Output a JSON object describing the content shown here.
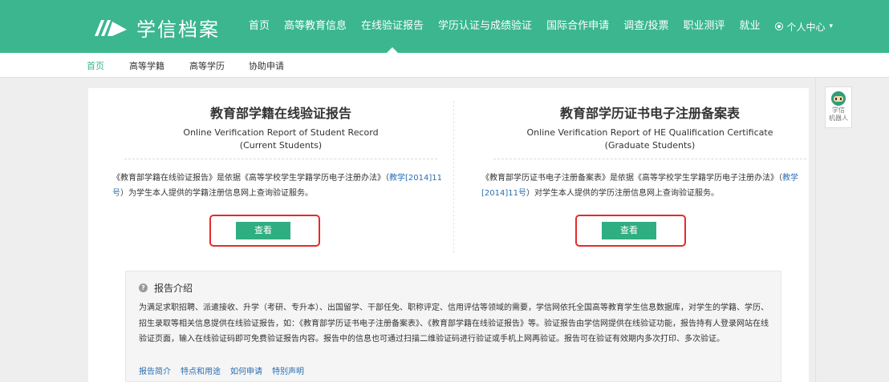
{
  "brand": {
    "name": "学信档案"
  },
  "nav": {
    "items": [
      {
        "label": "首页"
      },
      {
        "label": "高等教育信息"
      },
      {
        "label": "在线验证报告"
      },
      {
        "label": "学历认证与成绩验证"
      },
      {
        "label": "国际合作申请"
      },
      {
        "label": "调查/投票"
      },
      {
        "label": "职业测评"
      },
      {
        "label": "就业"
      }
    ],
    "active_index": 2,
    "user_label": "个人中心"
  },
  "subnav": {
    "items": [
      {
        "label": "首页"
      },
      {
        "label": "高等学籍"
      },
      {
        "label": "高等学历"
      },
      {
        "label": "协助申请"
      }
    ]
  },
  "cards": [
    {
      "title": "教育部学籍在线验证报告",
      "subtitle_line1": "Online Verification Report of Student Record",
      "subtitle_line2": "(Current Students)",
      "desc_pre": "《教育部学籍在线验证报告》是依据《高等学校学生学籍学历电子注册办法》（",
      "desc_link": "教学[2014]11号",
      "desc_post": "）为学生本人提供的学籍注册信息网上查询验证服务。",
      "button": "查看"
    },
    {
      "title": "教育部学历证书电子注册备案表",
      "subtitle_line1": "Online Verification Report of HE Qualification Certificate",
      "subtitle_line2": "(Graduate Students)",
      "desc_pre": "《教育部学历证书电子注册备案表》是依据《高等学校学生学籍学历电子注册办法》（",
      "desc_link": "教学[2014]11号",
      "desc_post": "）对学生本人提供的学历注册信息网上查询验证服务。",
      "button": "查看"
    }
  ],
  "intro": {
    "title": "报告介绍",
    "text": "为满足求职招聘、派遣接收、升学（考研、专升本）、出国留学、干部任免、职称评定、信用评估等领域的需要，学信网依托全国高等教育学生信息数据库，对学生的学籍、学历、招生录取等相关信息提供在线验证报告，如：《教育部学历证书电子注册备案表》、《教育部学籍在线验证报告》等。验证报告由学信网提供在线验证功能，报告持有人登录网站在线验证页面，输入在线验证码即可免费验证报告内容。报告中的信息也可通过扫描二维验证码进行验证或手机上网再验证。报告可在验证有效期内多次打印、多次验证。",
    "links": [
      {
        "label": "报告简介"
      },
      {
        "label": "特点和用途"
      },
      {
        "label": "如何申请"
      },
      {
        "label": "特别声明"
      }
    ]
  },
  "robot": {
    "line1": "学信",
    "line2": "机器人"
  },
  "colors": {
    "brand_green": "#3bb68e",
    "button_green": "#2fae82",
    "highlight_red": "#e52b2b",
    "link_blue": "#2a6fb2"
  }
}
